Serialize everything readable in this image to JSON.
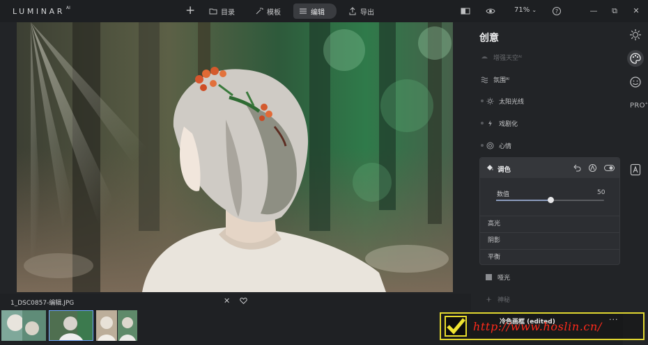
{
  "app": {
    "logo": "LUMINAR",
    "logo_version": "AI"
  },
  "toolbar": {
    "add_label": "+",
    "catalog_label": "目录",
    "templates_label": "模板",
    "edit_label": "编辑",
    "export_label": "导出",
    "zoom_label": "71%",
    "zoom_caret": "⌄"
  },
  "window": {
    "minimize": "—",
    "restore": "⧉",
    "close": "✕"
  },
  "filmstrip": {
    "filename": "1_DSC0857-编辑.JPG",
    "close": "✕"
  },
  "panel": {
    "title": "创意",
    "items": [
      {
        "label": "增强天空",
        "sup": "AI"
      },
      {
        "label": "氛围",
        "sup": "AI"
      },
      {
        "label": "太阳光线"
      },
      {
        "label": "戏剧化"
      },
      {
        "label": "心情"
      }
    ],
    "toning": {
      "title": "调色",
      "slider_label": "数值",
      "slider_value": "50",
      "slider_fraction": 0.5,
      "sub_items": [
        "高光",
        "阴影",
        "平衡"
      ]
    },
    "after_items": [
      {
        "label": "哑光"
      },
      {
        "label": "神秘"
      }
    ]
  },
  "rail": {
    "pro_label": "PRO",
    "pro_sup": "+"
  },
  "preset_bar": {
    "label": "冷色画框 (edited)",
    "more": "···"
  },
  "watermark": {
    "text": "http://www.hoslin.cn/"
  },
  "colors": {
    "accent": "#8b9bbd",
    "watermark_border": "#e2d830",
    "watermark_text": "#ff2a1a"
  }
}
